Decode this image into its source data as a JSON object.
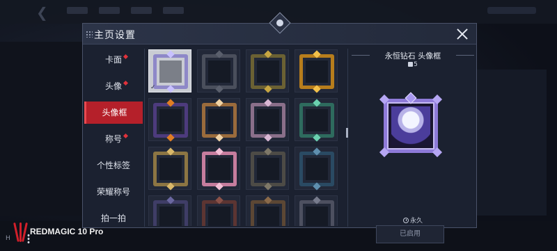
{
  "dialog": {
    "title": "主页设置",
    "close_icon": "close-icon",
    "top_icon": "lightbulb-gem-icon"
  },
  "sidebar": {
    "items": [
      {
        "label": "卡面",
        "badge": true,
        "active": false
      },
      {
        "label": "头像",
        "badge": true,
        "active": false
      },
      {
        "label": "头像框",
        "badge": false,
        "active": true
      },
      {
        "label": "称号",
        "badge": true,
        "active": false
      },
      {
        "label": "个性标签",
        "badge": false,
        "active": false
      },
      {
        "label": "荣耀称号",
        "badge": false,
        "active": false
      },
      {
        "label": "拍一拍",
        "badge": false,
        "active": false
      }
    ]
  },
  "frames": [
    {
      "name": "default-silver-frame",
      "color": "#8e88c8",
      "deco": "#c8c1ff",
      "selected": true
    },
    {
      "name": "plain-gray-frame",
      "color": "#4a4f5c",
      "deco": "#5a5f6c",
      "selected": false
    },
    {
      "name": "forest-leaf-frame",
      "color": "#6b6133",
      "deco": "#c7a642",
      "selected": false
    },
    {
      "name": "golden-flame-frame",
      "color": "#b77d1c",
      "deco": "#f2c04a",
      "selected": false
    },
    {
      "name": "halloween-frame",
      "color": "#4d3b7d",
      "deco": "#e07d23",
      "selected": false
    },
    {
      "name": "lantern-festival-frame",
      "color": "#9a6b3c",
      "deco": "#f0d2a5",
      "selected": false
    },
    {
      "name": "rose-silver-frame",
      "color": "#8a6f8a",
      "deco": "#d9b7d4",
      "selected": false
    },
    {
      "name": "jade-emerald-frame",
      "color": "#2e6b5e",
      "deco": "#6bd1b0",
      "selected": false
    },
    {
      "name": "gold-wing-frame",
      "color": "#8c7543",
      "deco": "#d9b86a",
      "selected": false
    },
    {
      "name": "pink-blossom-frame",
      "color": "#c67d9e",
      "deco": "#f3bfd6",
      "selected": false
    },
    {
      "name": "bronze-shield-frame",
      "color": "#4d4b46",
      "deco": "#7e7868",
      "selected": false
    },
    {
      "name": "frost-blue-frame",
      "color": "#2a4a63",
      "deco": "#5f8fae",
      "selected": false
    },
    {
      "name": "violet-crown-frame",
      "color": "#3f3d66",
      "deco": "#6a67a0",
      "selected": false
    },
    {
      "name": "crimson-frame",
      "color": "#5c3532",
      "deco": "#8a5148",
      "selected": false
    },
    {
      "name": "amber-frame",
      "color": "#5c4734",
      "deco": "#8a6a4a",
      "selected": false
    },
    {
      "name": "steel-frame",
      "color": "#4d5060",
      "deco": "#777b8c",
      "selected": false
    }
  ],
  "detail": {
    "frame_name": "永恒钻石 头像框",
    "rank_value": "5",
    "duration": "永久",
    "status_button": "已启用",
    "accent": "#8e7ad8"
  },
  "watermark": {
    "brand": "REDMAGIC 10 Pro",
    "sys_label": "H"
  },
  "colors": {
    "active_tab": "#b5202a",
    "badge": "#e0323b"
  }
}
